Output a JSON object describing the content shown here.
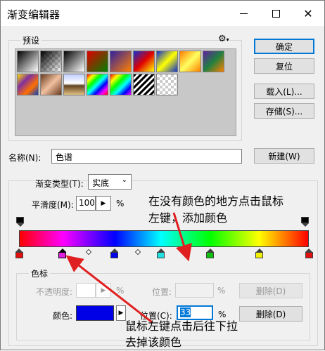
{
  "window": {
    "title": "渐变编辑器"
  },
  "presets": {
    "label": "预设",
    "swatches": [
      {
        "name": "foreground-to-background",
        "bg": "linear-gradient(135deg,#000,#fff)"
      },
      {
        "name": "foreground-to-transparent",
        "bg": "linear-gradient(135deg,#000 0%,rgba(0,0,0,0) 100%), repeating-conic-gradient(#ccc 0% 25%, #fff 0% 50%) 0 0/8px 8px"
      },
      {
        "name": "black-white",
        "bg": "linear-gradient(135deg,#000,#fff)"
      },
      {
        "name": "red-green",
        "bg": "linear-gradient(135deg,#e00000,#008000)"
      },
      {
        "name": "violet-orange",
        "bg": "linear-gradient(135deg,#3020a0,#ff8000)"
      },
      {
        "name": "blue-red-yellow",
        "bg": "linear-gradient(135deg,#1030d0,#e00000,#ffff00)"
      },
      {
        "name": "blue-yellow-blue",
        "bg": "linear-gradient(135deg,#1030d0,#ffff00,#1030d0)"
      },
      {
        "name": "orange-yellow-orange",
        "bg": "linear-gradient(135deg,#ff8000,#ffff60,#ff8000)"
      },
      {
        "name": "violet-green-orange",
        "bg": "linear-gradient(135deg,#6020a0,#208040,#ff8000)"
      },
      {
        "name": "yellow-violet-orange-blue",
        "bg": "linear-gradient(135deg,#ffdd00,#8030a0,#ff7000,#1040c0)"
      },
      {
        "name": "copper",
        "bg": "linear-gradient(135deg,#6a3a20,#f0c0a0,#6a3a20)"
      },
      {
        "name": "chrome",
        "bg": "linear-gradient(180deg,#c0d0ff 0%,#ffffff 45%,#604020 55%,#e0c080 100%)"
      },
      {
        "name": "spectrum",
        "bg": "linear-gradient(135deg,#f00,#ff0,#0f0,#0ff,#00f,#f0f,#f00)"
      },
      {
        "name": "transparent-rainbow",
        "bg": "linear-gradient(135deg,#f00,#ff0,#0f0,#0ff,#00f,#f0f)"
      },
      {
        "name": "transparent-stripes",
        "bg": "repeating-linear-gradient(135deg,#000 0 3px,#fff 3px 6px)"
      },
      {
        "name": "transparent",
        "bg": "repeating-conic-gradient(#ccc 0% 25%, #fff 0% 50%) 0 0/8px 8px"
      }
    ]
  },
  "buttons": {
    "ok": "确定",
    "reset": "复位",
    "load": "载入(L)...",
    "save": "存储(S)...",
    "new": "新建(W)",
    "delete_opacity": "删除(D)",
    "delete_color": "删除(D)"
  },
  "name_row": {
    "label": "名称(N):",
    "value": "色谱"
  },
  "gradient": {
    "type_label": "渐变类型(T):",
    "type_value": "实底",
    "smooth_label": "平滑度(M):",
    "smooth_value": "100",
    "smooth_unit": "%"
  },
  "stops": {
    "label": "色标",
    "opacity_label": "不透明度:",
    "opacity_unit": "%",
    "opacity_position_label": "位置:",
    "opacity_position_unit": "%",
    "color_label": "颜色:",
    "color_value": "#0000e6",
    "position_label": "位置(C):",
    "position_value": "33",
    "position_unit": "%",
    "color_stops": [
      {
        "position": 0,
        "color": "#e01010"
      },
      {
        "position": 0.15,
        "color": "#e020e0",
        "selected": true
      },
      {
        "position": 0.33,
        "color": "#0000e6"
      },
      {
        "position": 0.49,
        "color": "#20e0e0"
      },
      {
        "position": 0.66,
        "color": "#10c010"
      },
      {
        "position": 0.83,
        "color": "#f0f000"
      },
      {
        "position": 1,
        "color": "#e01010"
      }
    ],
    "midpoints": [
      0.24,
      0.41
    ]
  },
  "annotations": {
    "top_line1": "在没有颜色的地方点击鼠标",
    "top_line2": "左键，添加颜色",
    "bottom_line1": "鼠标左键点击后往下拉",
    "bottom_line2": "去掉该颜色"
  },
  "colors": {
    "accent": "#0078d7",
    "annotation_arrow": "#e02020"
  }
}
